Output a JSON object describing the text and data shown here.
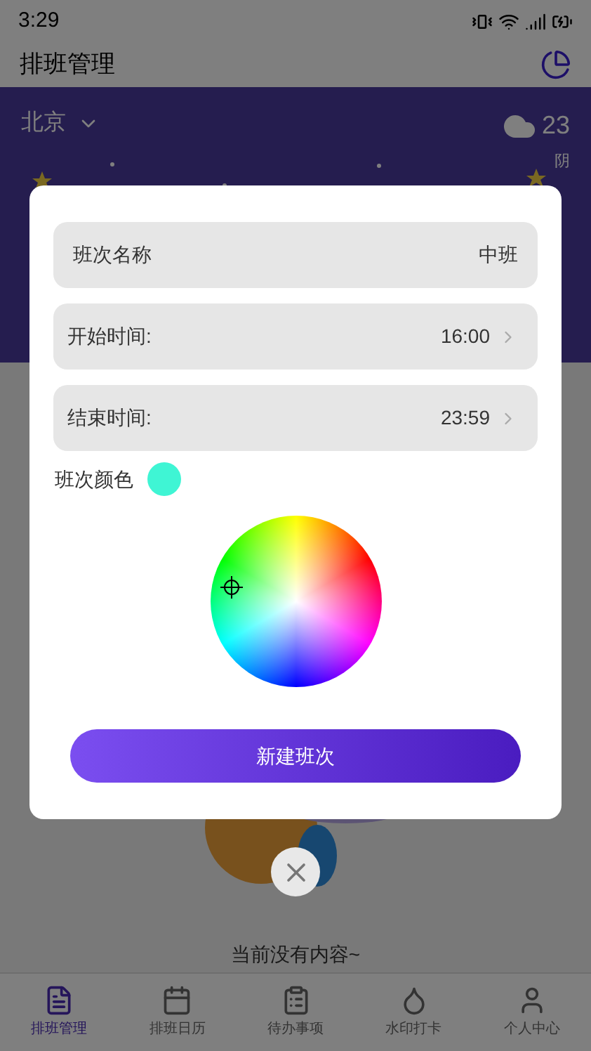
{
  "status_bar": {
    "time": "3:29"
  },
  "app_bar": {
    "title": "排班管理"
  },
  "weather": {
    "city": "北京",
    "temperature": "23",
    "condition": "阴"
  },
  "empty_state": {
    "text": "当前没有内容~"
  },
  "tabs": [
    {
      "label": "排班管理",
      "selected": true
    },
    {
      "label": "排班日历",
      "selected": false
    },
    {
      "label": "待办事项",
      "selected": false
    },
    {
      "label": "水印打卡",
      "selected": false
    },
    {
      "label": "个人中心",
      "selected": false
    }
  ],
  "dialog": {
    "fields": [
      {
        "kind": "text",
        "label": "班次名称",
        "value": "中班"
      },
      {
        "kind": "picker",
        "label": "开始时间:",
        "value": "16:00"
      },
      {
        "kind": "picker",
        "label": "结束时间:",
        "value": "23:59"
      }
    ],
    "color_label": "班次颜色",
    "color": "#3ff5d4",
    "button": "新建班次"
  }
}
